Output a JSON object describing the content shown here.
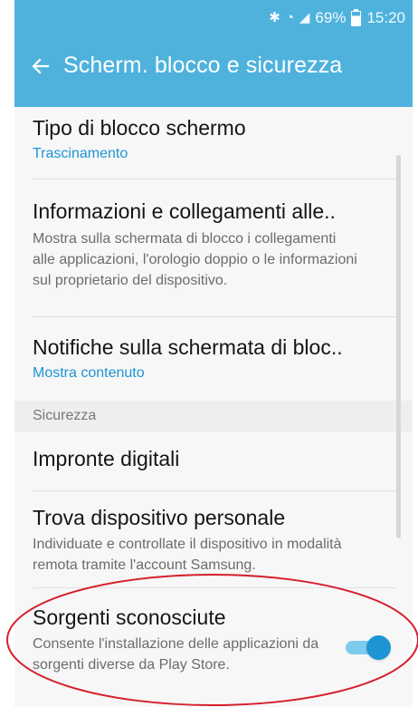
{
  "status_bar": {
    "bluetooth_icon": "bluetooth-icon",
    "wifi_icon": "wifi-icon",
    "signal_icon": "signal-icon",
    "battery": "69%",
    "time": "15:20"
  },
  "app_bar": {
    "back_icon": "back-arrow-icon",
    "title": "Scherm. blocco e sicurezza"
  },
  "items": [
    {
      "title": "Tipo di blocco schermo",
      "subtitle": "Trascinamento"
    },
    {
      "title": "Informazioni e collegamenti alle..",
      "description": "Mostra sulla schermata di blocco i collegamenti alle applicazioni, l'orologio doppio o le informazioni sul proprietario del dispositivo."
    },
    {
      "title": "Notifiche sulla schermata di bloc..",
      "subtitle": "Mostra contenuto"
    },
    {
      "section_label": "Sicurezza"
    },
    {
      "title": "Impronte digitali"
    },
    {
      "title": "Trova dispositivo personale",
      "description": "Individuate e controllate il dispositivo in modalità remota tramite l'account Samsung."
    },
    {
      "title": "Sorgenti sconosciute",
      "description": "Consente l'installazione delle applicazioni da sorgenti diverse da Play Store.",
      "enabled": true
    }
  ],
  "colors": {
    "app_bar": "#4fb2dd",
    "accent": "#1d95d4",
    "annotation_circle": "#d51f2b"
  }
}
